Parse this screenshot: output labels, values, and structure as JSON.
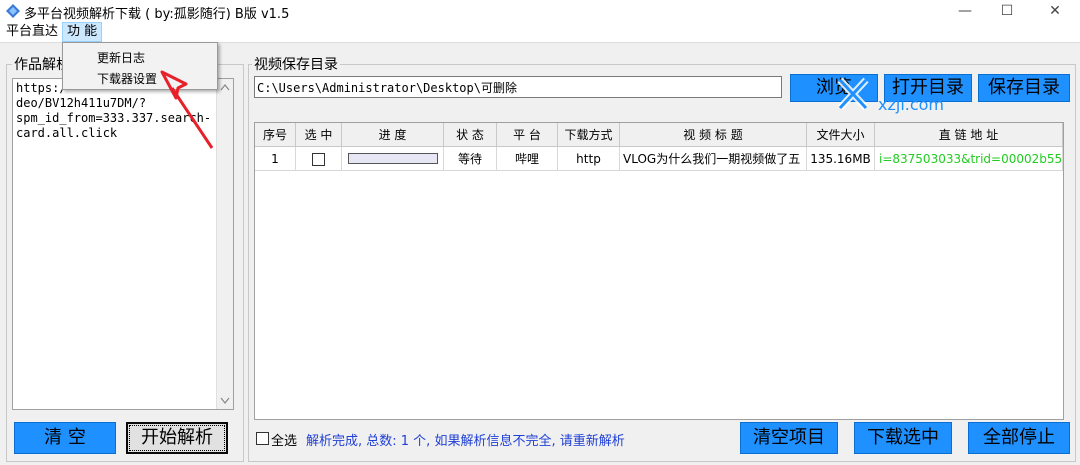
{
  "window": {
    "title": "多平台视频解析下载 ( by:孤影随行) B版 v1.5",
    "min": "—",
    "max": "☐",
    "close": "✕"
  },
  "menu": {
    "items": [
      "平台直达",
      "功 能"
    ],
    "dropdown": [
      "更新日志",
      "下载器设置"
    ]
  },
  "left": {
    "group_label": "作品解析",
    "url_text": "https:/\ndeo/BV12h411u7DM/?\nspm_id_from=333.337.search-\ncard.all.click",
    "clear_label": "清   空",
    "parse_label": "开始解析"
  },
  "save": {
    "label": "视频保存目录",
    "path": "C:\\Users\\Administrator\\Desktop\\可删除",
    "browse_label": "浏览",
    "open_label": "打开目录",
    "save_label": "保存目录"
  },
  "watermark": {
    "text": "xzji.com",
    "color": "#1e90ff"
  },
  "table": {
    "headers": [
      "序号",
      "选 中",
      "进 度",
      "状 态",
      "平 台",
      "下载方式",
      "视 频 标 题",
      "文件大小",
      "直 链 地 址"
    ],
    "rows": [
      {
        "index": "1",
        "progress": 0.0,
        "status": "等待",
        "platform": "哔哩",
        "method": "http",
        "title": "VLOG为什么我们一期视频做了五",
        "size": "135.16MB",
        "link": "i=837503033&trid=00002b55!"
      }
    ],
    "link_color": "#22cc22"
  },
  "bottom": {
    "select_all": "全选",
    "status": "解析完成, 总数:  1 个, 如果解析信息不完全, 请重新解析",
    "clear_items": "清空项目",
    "download_selected": "下载选中",
    "stop_all": "全部停止"
  },
  "colors": {
    "accent_button": "#1e90ff",
    "status_text": "#1f3fd6",
    "arrow": "#e8202a"
  }
}
